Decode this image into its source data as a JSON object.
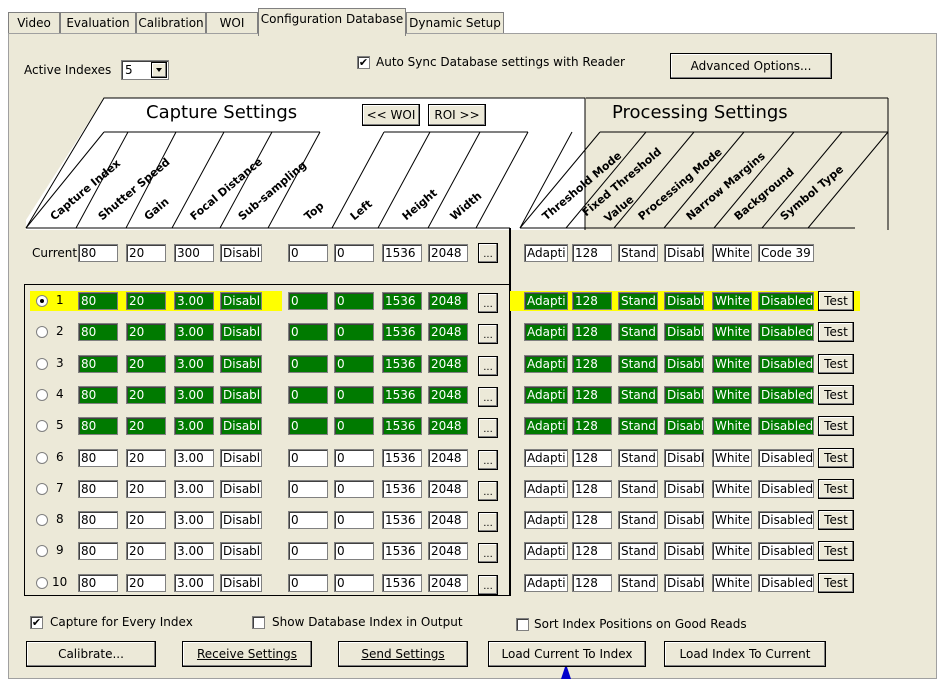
{
  "tabs": [
    "Video",
    "Evaluation",
    "Calibration",
    "WOI",
    "Configuration Database",
    "Dynamic Setup"
  ],
  "active_tab": "Configuration Database",
  "active_indexes": {
    "label": "Active Indexes",
    "value": "5"
  },
  "auto_sync": {
    "label": "Auto Sync Database settings with Reader",
    "checked": true
  },
  "advanced_button": "Advanced Options...",
  "capture": {
    "title": "Capture Settings",
    "woi_prev": "<< WOI",
    "roi_next": "ROI >>",
    "headers": [
      "Capture Index",
      "Shutter Speed",
      "Gain",
      "Focal Distance",
      "Sub-sampling",
      "Top",
      "Left",
      "Height",
      "Width"
    ]
  },
  "processing": {
    "title": "Processing Settings",
    "headers": [
      "Threshold Mode",
      "Fixed Threshold",
      "Value",
      "Processing Mode",
      "Narrow Margins",
      "Background",
      "Symbol Type"
    ]
  },
  "current": {
    "label": "Current",
    "capture": [
      "80",
      "20",
      "300",
      "Disabl",
      "0",
      "0",
      "1536",
      "2048"
    ],
    "processing": [
      "Adapti",
      "128",
      "Stand",
      "Disabl",
      "White",
      "Code 39"
    ]
  },
  "rows": [
    {
      "index": "1",
      "selected": true,
      "active": true,
      "capture": [
        "80",
        "20",
        "3.00",
        "Disabl",
        "0",
        "0",
        "1536",
        "2048"
      ],
      "processing": [
        "Adapti",
        "128",
        "Stand",
        "Disabl",
        "White",
        "Disabled"
      ]
    },
    {
      "index": "2",
      "selected": false,
      "active": true,
      "capture": [
        "80",
        "20",
        "3.00",
        "Disabl",
        "0",
        "0",
        "1536",
        "2048"
      ],
      "processing": [
        "Adapti",
        "128",
        "Stand",
        "Disabl",
        "White",
        "Disabled"
      ]
    },
    {
      "index": "3",
      "selected": false,
      "active": true,
      "capture": [
        "80",
        "20",
        "3.00",
        "Disabl",
        "0",
        "0",
        "1536",
        "2048"
      ],
      "processing": [
        "Adapti",
        "128",
        "Stand",
        "Disabl",
        "White",
        "Disabled"
      ]
    },
    {
      "index": "4",
      "selected": false,
      "active": true,
      "capture": [
        "80",
        "20",
        "3.00",
        "Disabl",
        "0",
        "0",
        "1536",
        "2048"
      ],
      "processing": [
        "Adapti",
        "128",
        "Stand",
        "Disabl",
        "White",
        "Disabled"
      ]
    },
    {
      "index": "5",
      "selected": false,
      "active": true,
      "capture": [
        "80",
        "20",
        "3.00",
        "Disabl",
        "0",
        "0",
        "1536",
        "2048"
      ],
      "processing": [
        "Adapti",
        "128",
        "Stand",
        "Disabl",
        "White",
        "Disabled"
      ]
    },
    {
      "index": "6",
      "selected": false,
      "active": false,
      "capture": [
        "80",
        "20",
        "3.00",
        "Disabl",
        "0",
        "0",
        "1536",
        "2048"
      ],
      "processing": [
        "Adapti",
        "128",
        "Stand",
        "Disabl",
        "White",
        "Disabled"
      ]
    },
    {
      "index": "7",
      "selected": false,
      "active": false,
      "capture": [
        "80",
        "20",
        "3.00",
        "Disabl",
        "0",
        "0",
        "1536",
        "2048"
      ],
      "processing": [
        "Adapti",
        "128",
        "Stand",
        "Disabl",
        "White",
        "Disabled"
      ]
    },
    {
      "index": "8",
      "selected": false,
      "active": false,
      "capture": [
        "80",
        "20",
        "3.00",
        "Disabl",
        "0",
        "0",
        "1536",
        "2048"
      ],
      "processing": [
        "Adapti",
        "128",
        "Stand",
        "Disabl",
        "White",
        "Disabled"
      ]
    },
    {
      "index": "9",
      "selected": false,
      "active": false,
      "capture": [
        "80",
        "20",
        "3.00",
        "Disabl",
        "0",
        "0",
        "1536",
        "2048"
      ],
      "processing": [
        "Adapti",
        "128",
        "Stand",
        "Disabl",
        "White",
        "Disabled"
      ]
    },
    {
      "index": "10",
      "selected": false,
      "active": false,
      "capture": [
        "80",
        "20",
        "3.00",
        "Disabl",
        "0",
        "0",
        "1536",
        "2048"
      ],
      "processing": [
        "Adapti",
        "128",
        "Stand",
        "Disabl",
        "White",
        "Disabled"
      ]
    }
  ],
  "ellipsis": "...",
  "test_label": "Test",
  "options": {
    "capture_every": {
      "label": "Capture for Every Index",
      "checked": true
    },
    "show_db_index": {
      "label": "Show Database Index in Output",
      "checked": false
    },
    "sort_index": {
      "label": "Sort Index Positions on Good Reads",
      "checked": false
    }
  },
  "buttons": {
    "calibrate": "Calibrate...",
    "receive": "Receive Settings",
    "send": "Send Settings",
    "load_current": "Load Current To Index",
    "load_index": "Load Index To Current"
  },
  "colors": {
    "active_field": "#007a00",
    "highlight": "#ffff00",
    "pointer": "#0000cc"
  }
}
